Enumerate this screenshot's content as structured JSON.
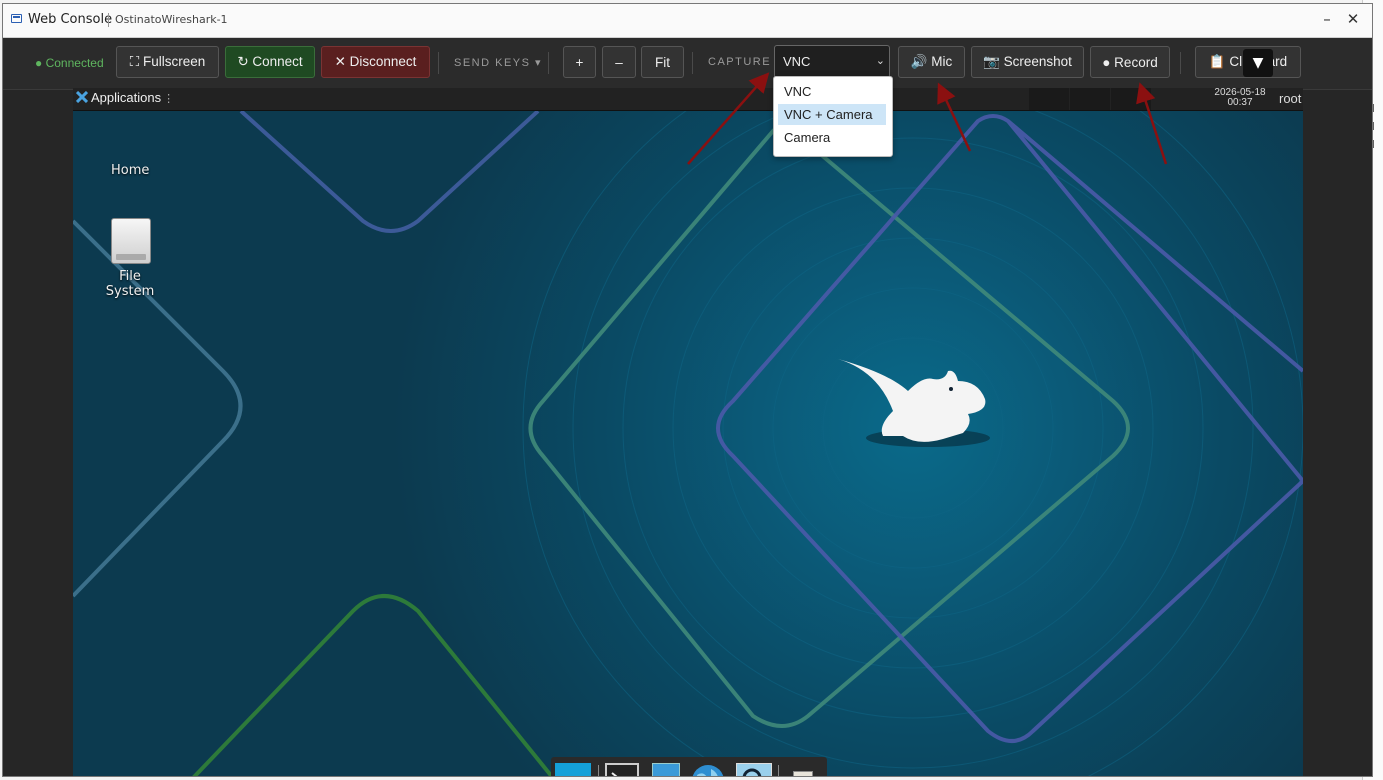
{
  "window": {
    "title": "Web Console",
    "subtitle": "OstinatoWireshark-1",
    "minimize": "–",
    "close": "✕"
  },
  "toolbar": {
    "status": "● Connected",
    "fullscreen": "⛶ Fullscreen",
    "connect": "↻ Connect",
    "disconnect": "✕ Disconnect",
    "send_keys": "SEND KEYS ▾",
    "zoom_in": "+",
    "zoom_out": "–",
    "fit": "Fit",
    "capture_label": "CAPTURE",
    "capture_value": "VNC",
    "mic": "🔊 Mic",
    "screenshot": "📷 Screenshot",
    "record": "● Record",
    "clipboard": "📋 Clipboard",
    "overlay_toggle": "▼"
  },
  "capture_options": [
    "VNC",
    "VNC + Camera",
    "Camera"
  ],
  "capture_selected_highlight": "VNC + Camera",
  "remote": {
    "applications": "Applications",
    "apps_dots": "⋮",
    "clock_date": "2026-05-18",
    "clock_time": "00:37",
    "user": "root",
    "desktop_icons": [
      "Home",
      "File System"
    ]
  },
  "colors": {
    "status_green": "#5fb65f",
    "connect_bg": "#1f4a22",
    "disconnect_bg": "#5a1f1f",
    "arrow": "#8b1010",
    "desktop_bg": "#0c3a4f"
  }
}
